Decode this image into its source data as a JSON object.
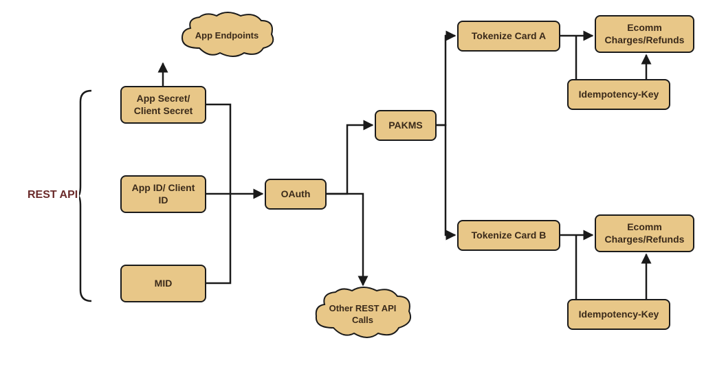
{
  "diagram": {
    "title_label": "REST API",
    "nodes": {
      "app_secret": "App Secret/ Client Secret",
      "app_id": "App ID/ Client ID",
      "mid": "MID",
      "oauth": "OAuth",
      "pakms": "PAKMS",
      "tokenize_a": "Tokenize Card A",
      "tokenize_b": "Tokenize Card B",
      "ecomm_a": "Ecomm Charges/Refunds",
      "ecomm_b": "Ecomm Charges/Refunds",
      "idempotency_a": "Idempotency-Key",
      "idempotency_b": "Idempotency-Key"
    },
    "clouds": {
      "app_endpoints": "App Endpoints",
      "other_calls": "Other REST API Calls"
    }
  }
}
